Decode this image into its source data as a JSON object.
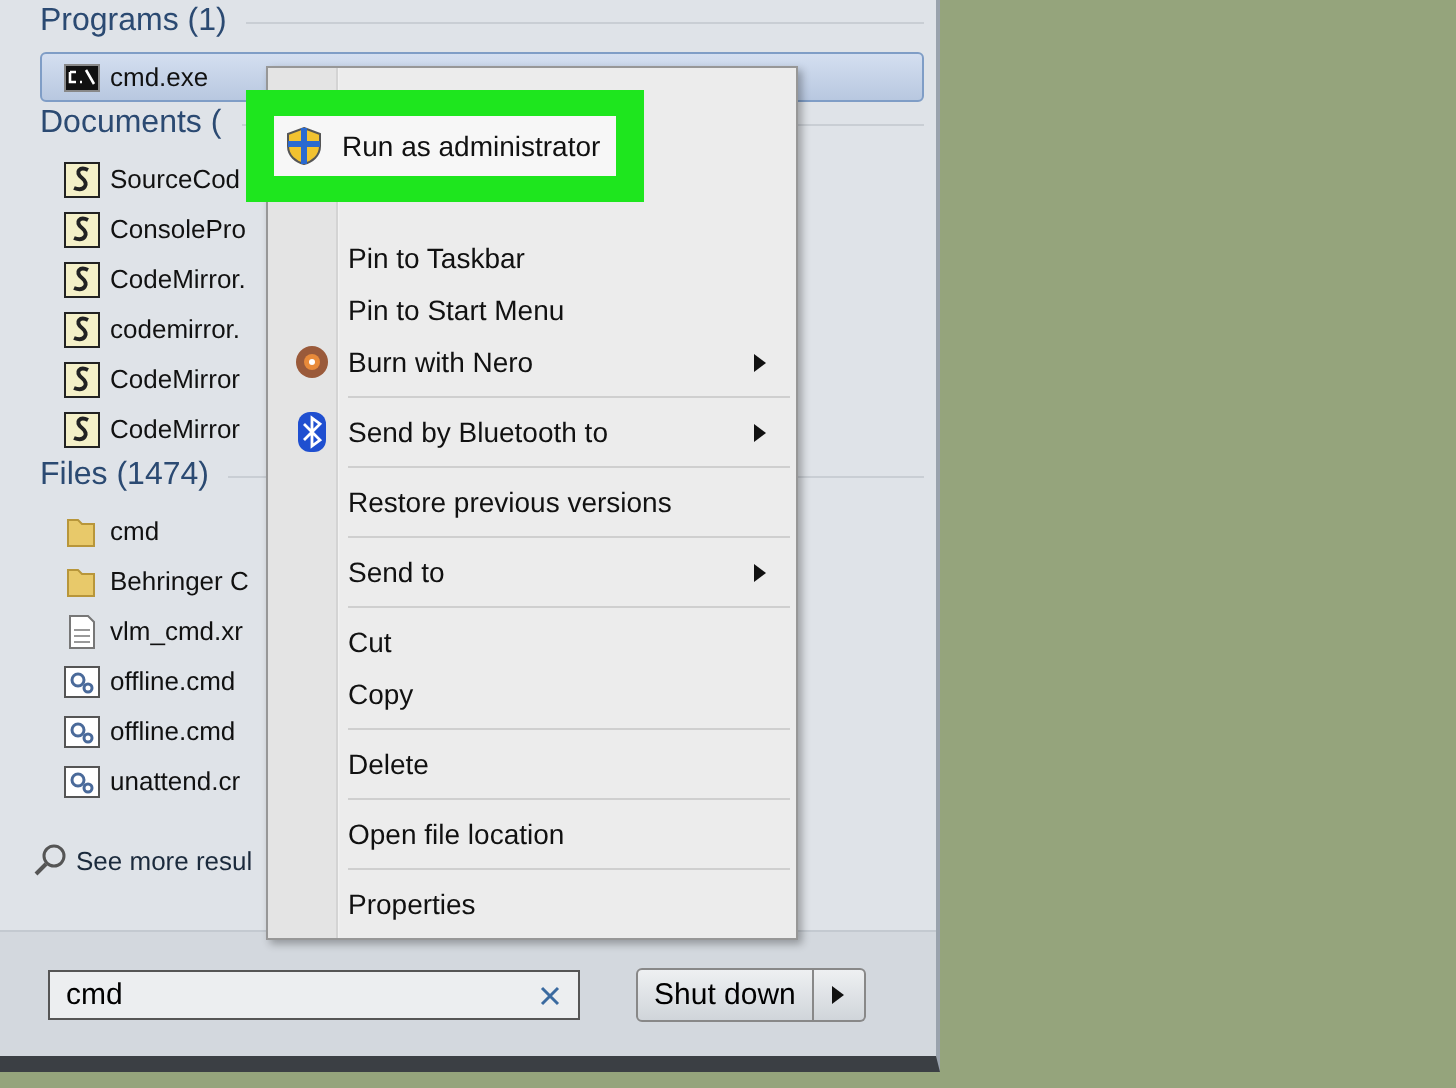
{
  "sections": [
    {
      "title": "Programs (1)",
      "items": [
        {
          "label": "cmd.exe",
          "kind": "console",
          "selected": true
        }
      ]
    },
    {
      "title": "Documents (",
      "items": [
        {
          "label": "SourceCod",
          "kind": "script",
          "selected": false
        },
        {
          "label": "ConsolePro",
          "kind": "script",
          "selected": false
        },
        {
          "label": "CodeMirror.",
          "kind": "script",
          "selected": false
        },
        {
          "label": "codemirror.",
          "kind": "script",
          "selected": false
        },
        {
          "label": "CodeMirror",
          "kind": "script",
          "selected": false
        },
        {
          "label": "CodeMirror",
          "kind": "script",
          "selected": false
        }
      ]
    },
    {
      "title": "Files (1474)",
      "items": [
        {
          "label": "cmd",
          "kind": "folder",
          "selected": false
        },
        {
          "label": "Behringer C",
          "kind": "folder",
          "selected": false
        },
        {
          "label": "vlm_cmd.xr",
          "kind": "xml",
          "selected": false
        },
        {
          "label": "offline.cmd",
          "kind": "batch",
          "selected": false
        },
        {
          "label": "offline.cmd",
          "kind": "batch",
          "selected": false
        },
        {
          "label": "unattend.cr",
          "kind": "batch",
          "selected": false
        }
      ]
    }
  ],
  "see_more": "See more resul",
  "search": {
    "value": "cmd"
  },
  "shutdown": {
    "label": "Shut down"
  },
  "highlighted_item": {
    "label": "Run as administrator"
  },
  "context_menu": [
    {
      "kind": "plain",
      "label": "Pin to Taskbar",
      "submenu": false
    },
    {
      "kind": "plain",
      "label": "Pin to Start Menu",
      "submenu": false
    },
    {
      "kind": "disc",
      "label": "Burn with Nero",
      "submenu": true
    },
    {
      "kind": "separator"
    },
    {
      "kind": "bluetooth",
      "label": "Send by Bluetooth to",
      "submenu": true
    },
    {
      "kind": "separator"
    },
    {
      "kind": "plain",
      "label": "Restore previous versions",
      "submenu": false
    },
    {
      "kind": "separator"
    },
    {
      "kind": "plain",
      "label": "Send to",
      "submenu": true
    },
    {
      "kind": "separator"
    },
    {
      "kind": "plain",
      "label": "Cut",
      "submenu": false
    },
    {
      "kind": "plain",
      "label": "Copy",
      "submenu": false
    },
    {
      "kind": "separator"
    },
    {
      "kind": "plain",
      "label": "Delete",
      "submenu": false
    },
    {
      "kind": "separator"
    },
    {
      "kind": "plain",
      "label": "Open file location",
      "submenu": false
    },
    {
      "kind": "separator"
    },
    {
      "kind": "plain",
      "label": "Properties",
      "submenu": false
    }
  ]
}
